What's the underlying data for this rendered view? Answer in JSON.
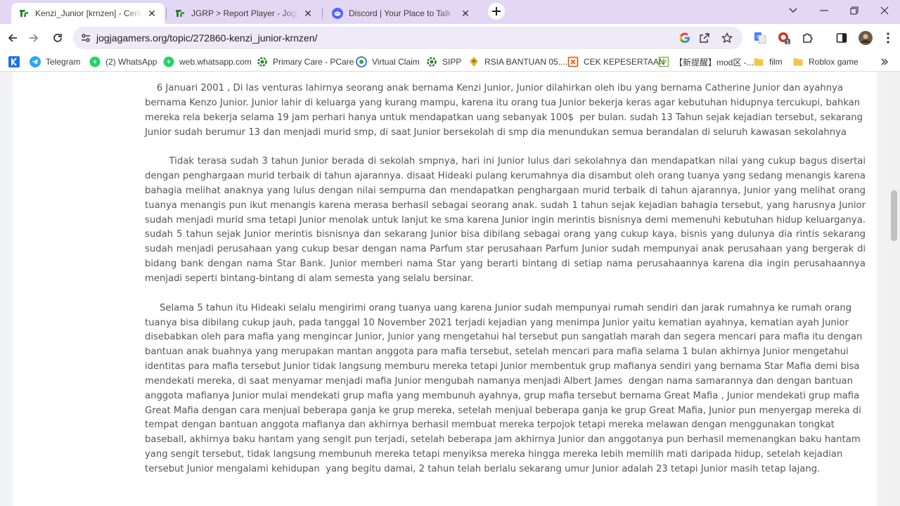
{
  "tabs": [
    {
      "title": "Kenzi_Junior [krnzen] - Cerita Karangan",
      "favicon": "jgrp-icon",
      "active": true
    },
    {
      "title": "JGRP > Report Player - Jogjagamers",
      "favicon": "jgrp-icon",
      "active": false
    },
    {
      "title": "Discord | Your Place to Talk and Hang Out",
      "favicon": "discord-icon",
      "active": false
    }
  ],
  "address_bar": {
    "url": "jogjagamers.org/topic/272860-kenzi_junior-krnzen/"
  },
  "bookmarks": [
    {
      "label": "",
      "icon": "k-icon"
    },
    {
      "label": "Telegram",
      "icon": "telegram-icon"
    },
    {
      "label": "(2) WhatsApp",
      "icon": "whatsapp-icon"
    },
    {
      "label": "web.whatsapp.com",
      "icon": "whatsapp-icon"
    },
    {
      "label": "Primary Care - PCare",
      "icon": "gear-icon"
    },
    {
      "label": "Virtual Claim",
      "icon": "bpjs-icon"
    },
    {
      "label": "SIPP",
      "icon": "gear-icon"
    },
    {
      "label": "RSIA BANTUAN 05....",
      "icon": "hospital-icon"
    },
    {
      "label": "CEK KEPESERTAAN",
      "icon": "box-icon"
    },
    {
      "label": "【新提醒】mod区 -...",
      "icon": "forum-icon"
    },
    {
      "label": "film",
      "icon": "folder-icon"
    },
    {
      "label": "Roblox game",
      "icon": "folder-icon"
    }
  ],
  "article": {
    "paragraphs": [
      "    6 Januari 2001 , Di las venturas lahirnya seorang anak bernama Kenzi Junior, Junior dilahirkan oleh ibu yang bernama Catherine Junior dan ayahnya bernama Kenzo Junior. Junior lahir di keluarga yang kurang mampu, karena itu orang tua Junior bekerja keras agar kebutuhan hidupnya tercukupi, bahkan mereka rela bekerja selama 19 jam perhari hanya untuk mendapatkan uang sebanyak 100$  per bulan. sudah 13 Tahun sejak kejadian tersebut, sekarang Junior sudah berumur 13 dan menjadi murid smp, di saat Junior bersekolah di smp dia menundukan semua berandalan di seluruh kawasan sekolahnya",
      "       Tidak terasa sudah 3 tahun Junior berada di sekolah smpnya, hari ini Junior lulus dari sekolahnya dan mendapatkan nilai yang cukup bagus disertai dengan penghargaan murid terbaik di tahun ajarannya. disaat Hideaki pulang kerumahnya dia disambut oleh orang tuanya yang sedang menangis karena bahagia melihat anaknya yang lulus dengan nilai sempurna dan mendapatkan penghargaan murid terbaik di tahun ajarannya, Junior yang melihat orang tuanya menangis pun ikut menangis karena merasa berhasil sebagai seorang anak. sudah 1 tahun sejak kejadian bahagia tersebut, yang harusnya Junior sudah menjadi murid sma tetapi Junior menolak untuk lanjut ke sma karena Junior ingin merintis bisnisnya demi memenuhi kebutuhan hidup keluarganya. sudah 5 tahun sejak Junior merintis bisnisnya dan sekarang Junior bisa dibilang sebagai orang yang cukup kaya, bisnis yang dulunya dia rintis sekarang sudah menjadi perusahaan yang cukup besar dengan nama Parfum star perusahaan Parfum Junior sudah mempunyai anak perusahaan yang bergerak di bidang bank dengan nama Star Bank. Junior memberi nama Star yang berarti bintang di setiap nama perusahaannya karena dia ingin perusahaannya menjadi seperti bintang-bintang di alam semesta yang selalu bersinar.",
      "     Selama 5 tahun itu Hideaki selalu mengirimi orang tuanya uang karena Junior sudah mempunyai rumah sendiri dan jarak rumahnya ke rumah orang tuanya bisa dibilang cukup jauh, pada tanggal 10 November 2021 terjadi kejadian yang menimpa Junior yaitu kematian ayahnya, kematian ayah Junior disebabkan oleh para mafia yang mengincar Junior, Junior yang mengetahui hal tersebut pun sangatlah marah dan segera mencari para mafia itu dengan bantuan anak buahnya yang merupakan mantan anggota para mafia tersebut, setelah mencari para mafia selama 1 bulan akhirnya Junior mengetahui identitas para mafia tersebut Junior tidak langsung memburu mereka tetapi Junior membentuk grup mafianya sendiri yang bernama Star Mafia demi bisa mendekati mereka, di saat menyamar menjadi mafia Junior mengubah namanya menjadi Albert James  dengan nama samarannya dan dengan bantuan anggota mafianya Junior mulai mendekati grup mafia yang membunuh ayahnya, grup mafia tersebut bernama Great Mafia , Junior mendekati grup mafia Great Mafia dengan cara menjual beberapa ganja ke grup mereka, setelah menjual beberapa ganja ke grup Great Mafia, Junior pun menyergap mereka di tempat dengan bantuan anggota mafianya dan akhirnya berhasil membuat mereka terpojok tetapi mereka melawan dengan menggunakan tongkat baseball, akhirnya baku hantam yang sengit pun terjadi, setelah beberapa jam akhirnya Junior dan anggotanya pun berhasil memenangkan baku hantam yang sengit tersebut, tidak langsung membunuh mereka tetapi menyiksa mereka hingga mereka lebih memilih mati daripada hidup, setelah kejadian tersebut Junior mengalami kehidupan  yang begitu damai, 2 tahun telah berlalu sekarang umur Junior adalah 23 tetapi Junior masih tetap lajang."
    ]
  }
}
